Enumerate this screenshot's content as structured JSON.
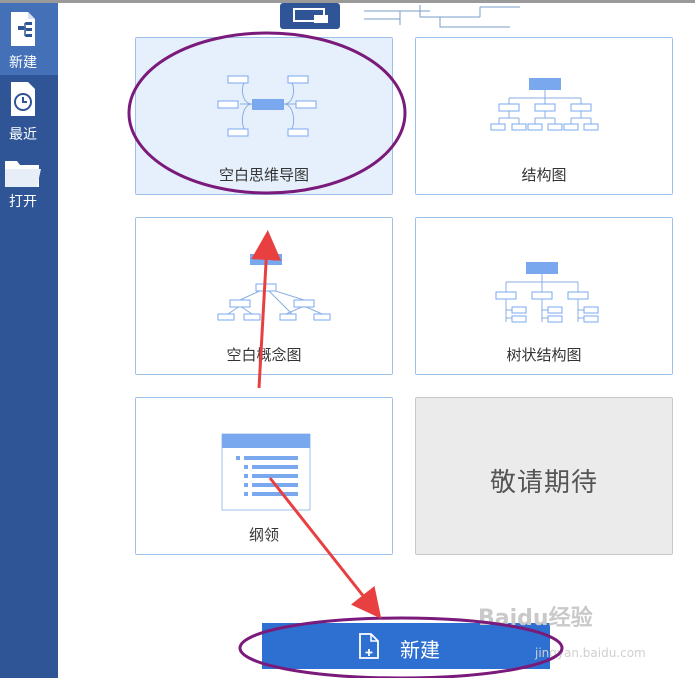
{
  "sidebar": {
    "items": [
      {
        "label": "新建",
        "icon": "new-file-icon"
      },
      {
        "label": "最近",
        "icon": "recent-clock-icon"
      },
      {
        "label": "打开",
        "icon": "folder-icon"
      }
    ]
  },
  "templates": [
    {
      "label": "空白思维导图",
      "icon": "mindmap-icon"
    },
    {
      "label": "结构图",
      "icon": "org-chart-icon"
    },
    {
      "label": "空白概念图",
      "icon": "concept-map-icon"
    },
    {
      "label": "树状结构图",
      "icon": "tree-chart-icon"
    },
    {
      "label": "纲领",
      "icon": "outline-icon"
    },
    {
      "label": "敬请期待",
      "icon": ""
    }
  ],
  "new_button": {
    "label": "新建"
  },
  "watermark": {
    "text": "Baidu经验",
    "sub": "jingyan.baidu.com"
  },
  "colors": {
    "sidebar": "#2f5596",
    "accent": "#2e6fd2",
    "card_border": "#9ec1ea",
    "annotation": "#7a1a7a",
    "arrow": "#e84040"
  }
}
